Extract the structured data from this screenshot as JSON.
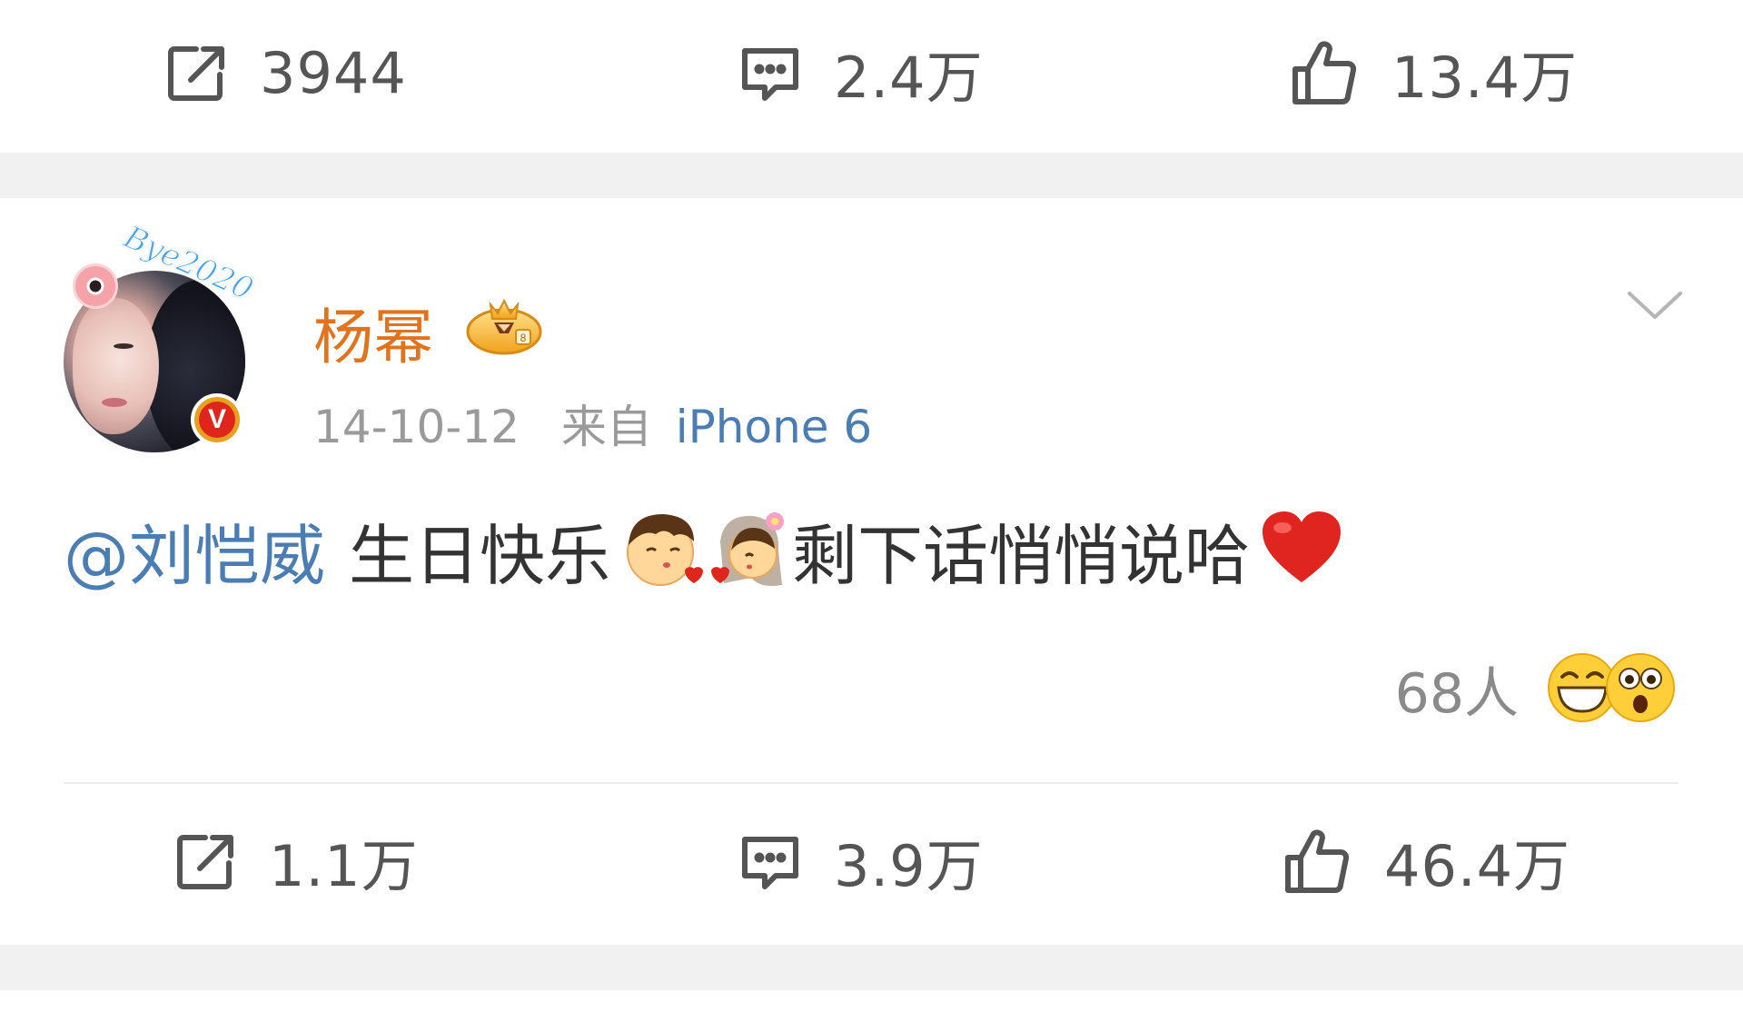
{
  "top_actions": {
    "repost": {
      "icon": "repost-icon",
      "count": "3944"
    },
    "comment": {
      "icon": "comment-icon",
      "count": "2.4万"
    },
    "like": {
      "icon": "thumbs-up-icon",
      "count": "13.4万"
    }
  },
  "post": {
    "avatar_deco_text": "Bye2020",
    "verified_badge": "V",
    "username": "杨幂",
    "member_badge": "crown-badge-icon",
    "date": "14-10-12",
    "source_prefix": "来自",
    "source_device": "iPhone 6",
    "mention": "@刘恺威",
    "text_before_emoji": "生日快乐",
    "emojis_mid": [
      "kiss-boy-emoji",
      "kiss-girl-emoji"
    ],
    "text_after_emoji": "剩下话悄悄说哈",
    "emoji_end": "red-heart-emoji",
    "reaction_count": "68人",
    "reaction_emojis": [
      "grin-emoji",
      "surprised-emoji"
    ],
    "actions": {
      "repost": {
        "icon": "repost-icon",
        "count": "1.1万"
      },
      "comment": {
        "icon": "comment-icon",
        "count": "3.9万"
      },
      "like": {
        "icon": "thumbs-up-icon",
        "count": "46.4万"
      }
    }
  },
  "colors": {
    "username": "#e2731c",
    "link": "#4a7db4",
    "muted": "#9a9a9a",
    "separator": "#f1f1f1",
    "badge_red": "#e0261c"
  }
}
